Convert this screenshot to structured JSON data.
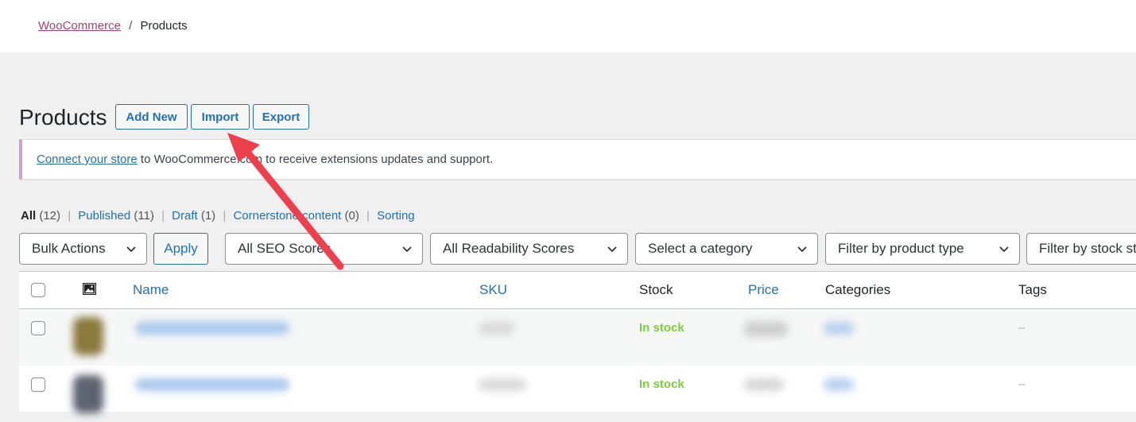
{
  "breadcrumb": {
    "parent": "WooCommerce",
    "separator": "/",
    "current": "Products"
  },
  "header": {
    "title": "Products",
    "buttons": {
      "add_new": "Add New",
      "import": "Import",
      "export": "Export"
    }
  },
  "notice": {
    "link_text": "Connect your store",
    "text": " to WooCommerce.com to receive extensions updates and support."
  },
  "views": {
    "all": {
      "label": "All",
      "count": "(12)"
    },
    "published": {
      "label": "Published",
      "count": "(11)"
    },
    "draft": {
      "label": "Draft",
      "count": "(1)"
    },
    "cornerstone": {
      "label": "Cornerstone content",
      "count": "(0)"
    },
    "sorting": {
      "label": "Sorting"
    },
    "separator": "|"
  },
  "filters": {
    "bulk_actions": "Bulk Actions",
    "apply": "Apply",
    "seo_scores": "All SEO Scores",
    "readability": "All Readability Scores",
    "category": "Select a category",
    "product_type": "Filter by product type",
    "stock_status": "Filter by stock status"
  },
  "table": {
    "columns": {
      "name": "Name",
      "sku": "SKU",
      "stock": "Stock",
      "price": "Price",
      "categories": "Categories",
      "tags": "Tags"
    },
    "rows": [
      {
        "stock": "In stock",
        "tags": "–"
      },
      {
        "stock": "In stock",
        "tags": "–"
      }
    ]
  },
  "colors": {
    "link": "#2271b1",
    "woo_purple": "#a14474",
    "in_stock": "#7ad03a",
    "annotation_arrow": "#ee3f4d"
  },
  "icons": {
    "image_column": "image-icon",
    "dropdown": "chevron-down-icon"
  }
}
